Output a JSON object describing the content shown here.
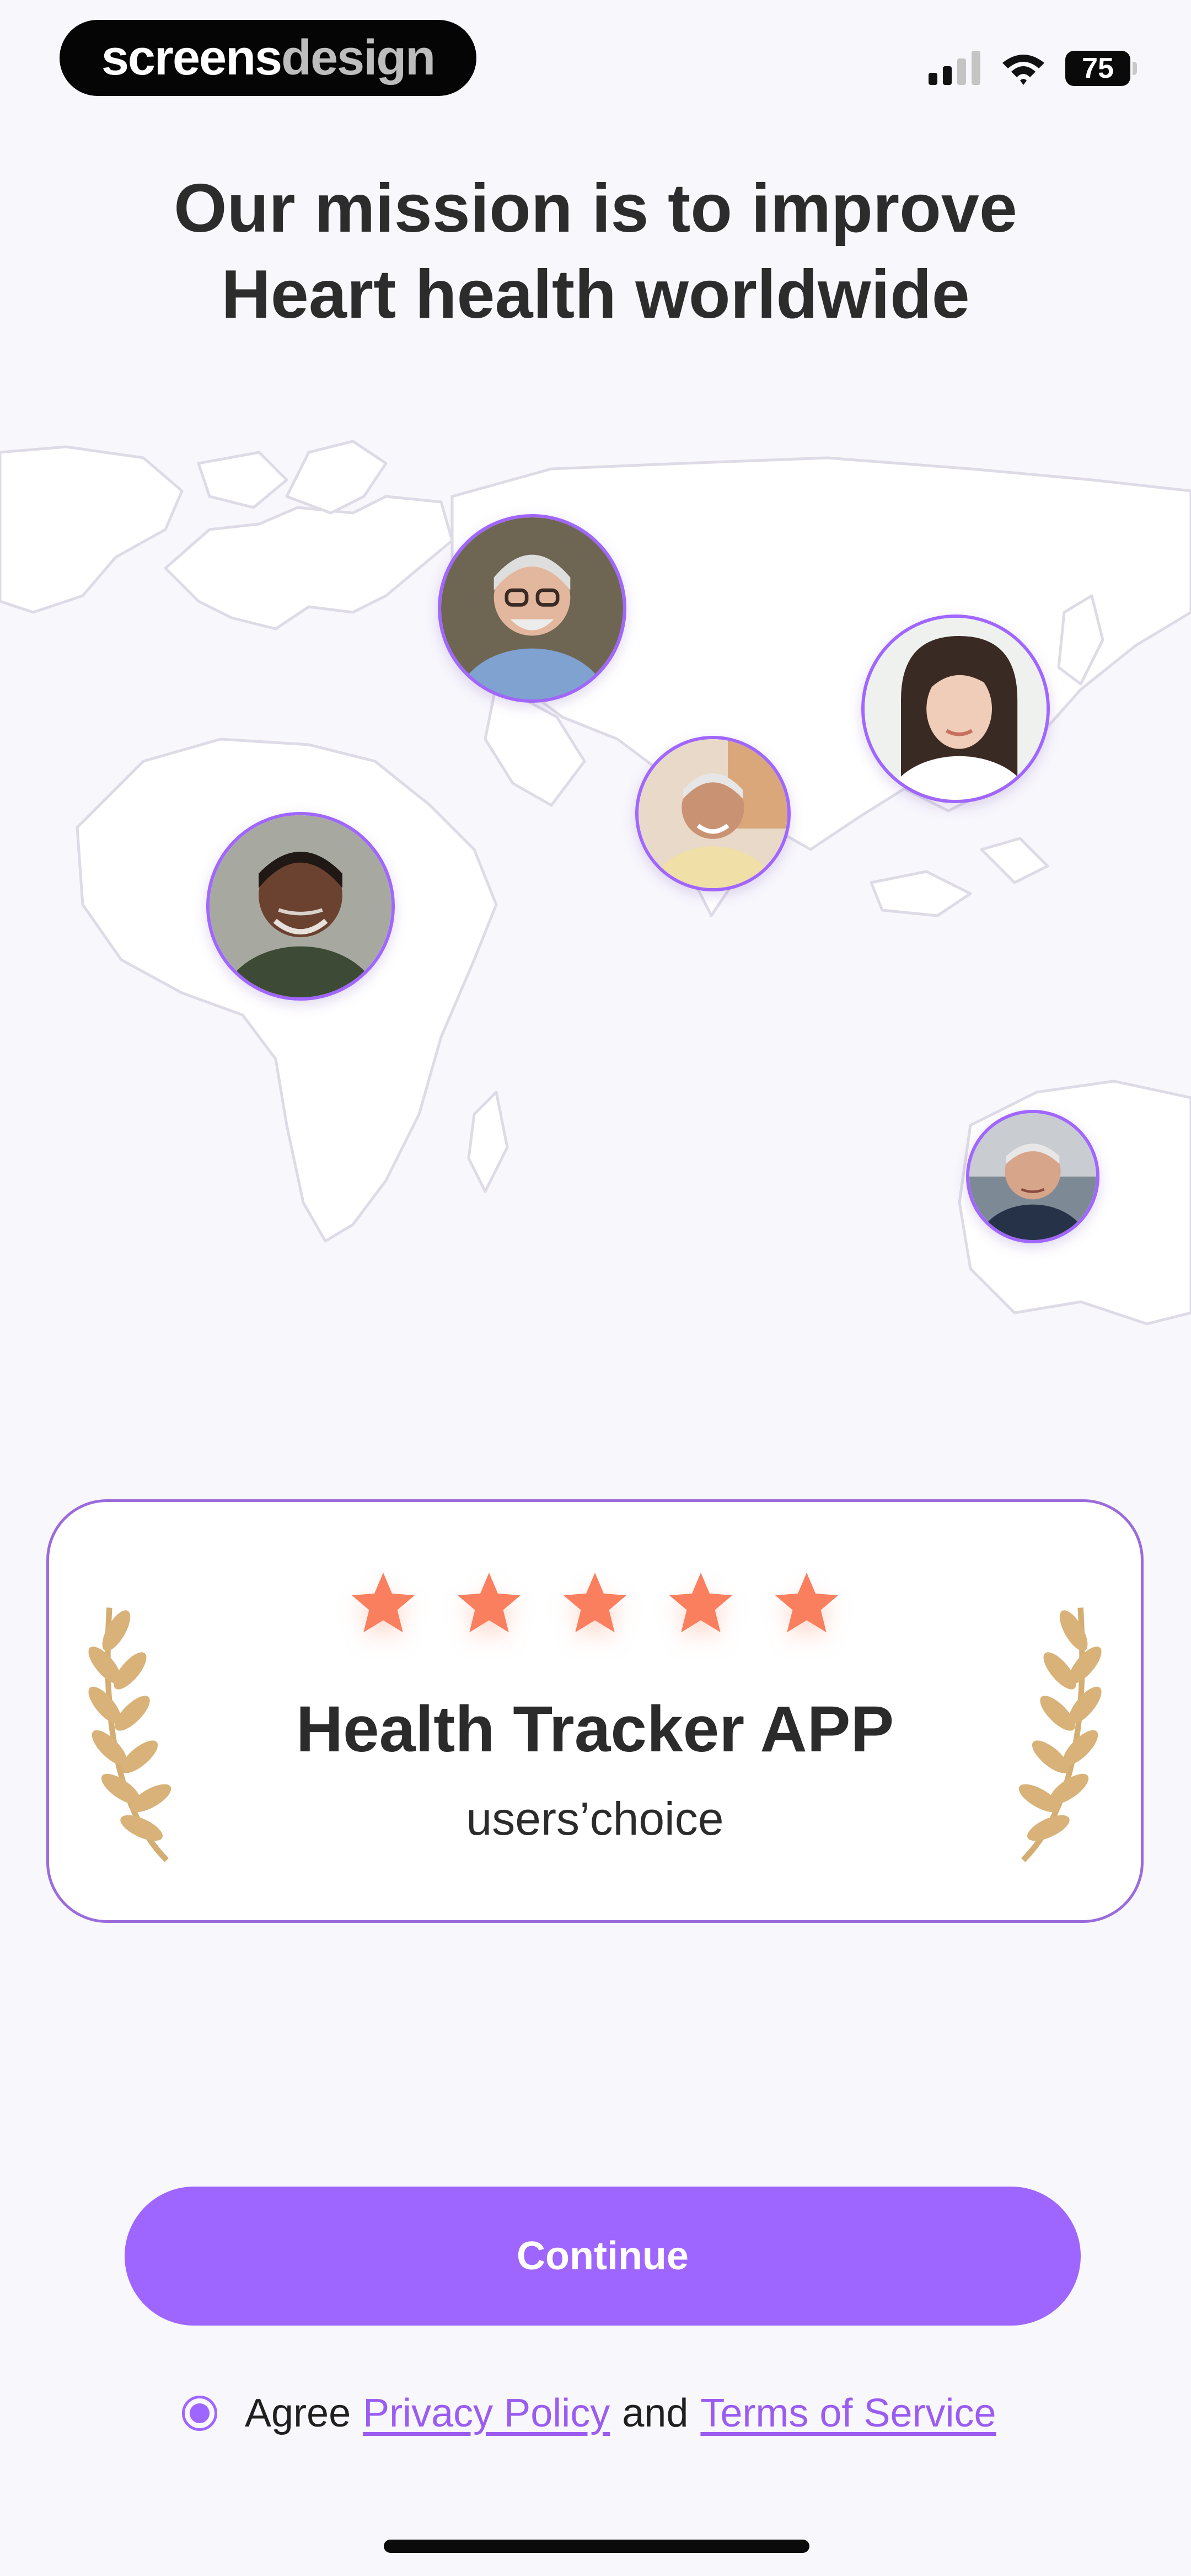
{
  "brand": {
    "part1": "screens",
    "part2": "design"
  },
  "status_bar": {
    "battery_level": "75",
    "signal_icon": "cellular-signal-icon",
    "wifi_icon": "wifi-icon"
  },
  "headline": {
    "line1": "Our mission is to improve",
    "line2": "Heart health worldwide"
  },
  "world_map": {
    "icon": "world-map-icon",
    "avatars": [
      {
        "name": "user-avatar-europe"
      },
      {
        "name": "user-avatar-east-asia"
      },
      {
        "name": "user-avatar-south-asia"
      },
      {
        "name": "user-avatar-africa"
      },
      {
        "name": "user-avatar-australia"
      }
    ]
  },
  "award_card": {
    "rating": 5,
    "max_rating": 5,
    "title": "Health Tracker APP",
    "subtitle": "users’choice",
    "left_icon": "laurel-wreath-left-icon",
    "right_icon": "laurel-wreath-right-icon"
  },
  "continue_button": {
    "label": "Continue"
  },
  "agreement": {
    "selected": true,
    "prefix": "Agree",
    "privacy_link": "Privacy Policy",
    "conjunction": "and",
    "terms_link": "Terms of Service"
  },
  "colors": {
    "accent": "#9f66ff",
    "background": "#f8f7fc",
    "star": "#fa7f5e",
    "laurel": "#d4ad72",
    "headline": "#2c2c2c"
  }
}
